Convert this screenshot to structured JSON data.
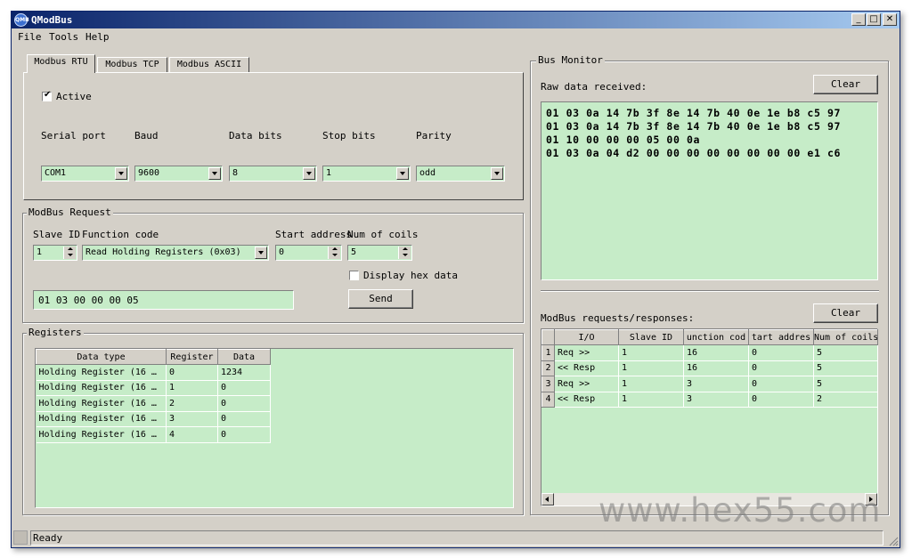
{
  "window": {
    "title": "QModBus",
    "app_icon_text": "QMB",
    "min": "_",
    "max": "□",
    "close": "✕"
  },
  "menu": [
    "File",
    "Tools",
    "Help"
  ],
  "tabs": [
    "Modbus RTU",
    "Modbus TCP",
    "Modbus ASCII"
  ],
  "rtu": {
    "active_label": "Active",
    "active_checked": true,
    "serial_port_label": "Serial port",
    "baud_label": "Baud",
    "data_bits_label": "Data bits",
    "stop_bits_label": "Stop bits",
    "parity_label": "Parity",
    "serial_port": "COM1",
    "baud": "9600",
    "data_bits": "8",
    "stop_bits": "1",
    "parity": "odd"
  },
  "request": {
    "group_label": "ModBus Request",
    "slave_id_label": "Slave ID",
    "function_code_label": "Function code",
    "start_address_label": "Start address",
    "num_coils_label": "Num of coils",
    "slave_id": "1",
    "function_code": "Read Holding Registers (0x03)",
    "start_address": "0",
    "num_coils": "5",
    "display_hex_label": "Display hex data",
    "display_hex_checked": false,
    "request_hex": "01  03  00 00  00 05",
    "send_label": "Send"
  },
  "registers": {
    "group_label": "Registers",
    "columns": [
      "Data type",
      "Register",
      "Data"
    ],
    "rows": [
      [
        "Holding Register (16 …",
        "0",
        "1234"
      ],
      [
        "Holding Register (16 …",
        "1",
        "0"
      ],
      [
        "Holding Register (16 …",
        "2",
        "0"
      ],
      [
        "Holding Register (16 …",
        "3",
        "0"
      ],
      [
        "Holding Register (16 …",
        "4",
        "0"
      ]
    ]
  },
  "monitor": {
    "group_label": "Bus Monitor",
    "raw_label": "Raw data received:",
    "clear_label": "Clear",
    "raw_lines": [
      "01 03 0a 14 7b 3f 8e 14 7b 40 0e 1e b8 c5 97",
      "01 03 0a 14 7b 3f 8e 14 7b 40 0e 1e b8 c5 97",
      "01 10 00 00 00 05 00 0a",
      "01 03 0a 04 d2 00 00 00 00 00 00 00 00 e1 c6"
    ],
    "reqresp_label": "ModBus requests/responses:",
    "clear2_label": "Clear",
    "columns": [
      "I/O",
      "Slave ID",
      "unction cod",
      "tart addres",
      "Num of coils"
    ],
    "rows": [
      [
        "1",
        "Req >>",
        "1",
        "16",
        "0",
        "5"
      ],
      [
        "2",
        "<< Resp",
        "1",
        "16",
        "0",
        "5"
      ],
      [
        "3",
        "Req >>",
        "1",
        "3",
        "0",
        "5"
      ],
      [
        "4",
        "<< Resp",
        "1",
        "3",
        "0",
        "2"
      ]
    ]
  },
  "status": {
    "text": "Ready"
  },
  "watermark": "www.hex55.com",
  "colors": {
    "field_green": "#c6ecc8",
    "face": "#d4d0c8",
    "title_blue": "#0a246a"
  }
}
